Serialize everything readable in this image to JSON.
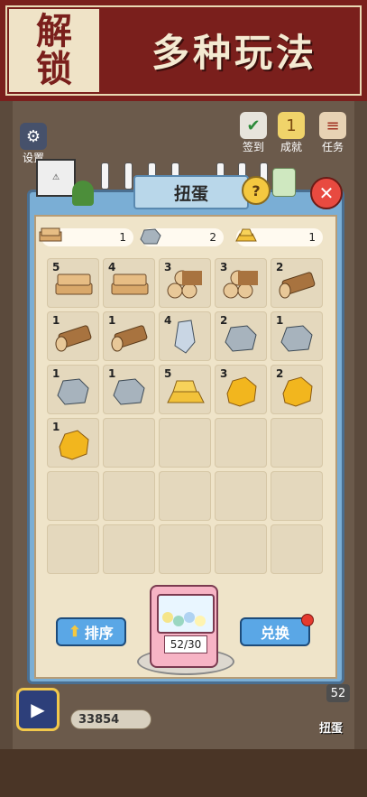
{
  "banner": {
    "left_line1": "解",
    "left_line2": "锁",
    "headline": "多种玩法"
  },
  "side": {
    "settings_label": "设置",
    "signin_label": "签到",
    "achievement_label": "成就",
    "task_label": "任务"
  },
  "hud": {
    "coins": "33854",
    "gacha_badge": "52",
    "gacha_label": "扭蛋"
  },
  "dialog": {
    "title": "扭蛋",
    "help_symbol": "?",
    "close_symbol": "✕",
    "counters": [
      {
        "icon": "wood-plank-icon",
        "value": "1"
      },
      {
        "icon": "stone-icon",
        "value": "2"
      },
      {
        "icon": "gold-bar-icon",
        "value": "1"
      }
    ],
    "inventory": [
      {
        "item": "wood-plank",
        "count": "5"
      },
      {
        "item": "wood-plank",
        "count": "4"
      },
      {
        "item": "log-pile",
        "count": "3"
      },
      {
        "item": "log-pile",
        "count": "3"
      },
      {
        "item": "log",
        "count": "2"
      },
      {
        "item": "log",
        "count": "1"
      },
      {
        "item": "log",
        "count": "1"
      },
      {
        "item": "crystal",
        "count": "4"
      },
      {
        "item": "stone",
        "count": "2"
      },
      {
        "item": "stone",
        "count": "1"
      },
      {
        "item": "stone",
        "count": "1"
      },
      {
        "item": "stone",
        "count": "1"
      },
      {
        "item": "gold-bar",
        "count": "5"
      },
      {
        "item": "gold-nugget",
        "count": "3"
      },
      {
        "item": "gold-nugget",
        "count": "2"
      },
      {
        "item": "gold-nugget",
        "count": "1"
      }
    ],
    "sort_label": "排序",
    "exchange_label": "兑换",
    "gacha_progress": "52/30"
  },
  "colors": {
    "banner_red": "#7a1f1c",
    "dialog_blue": "#7aaed5",
    "button_blue": "#5aa7e6",
    "paper": "#efe4c9"
  }
}
